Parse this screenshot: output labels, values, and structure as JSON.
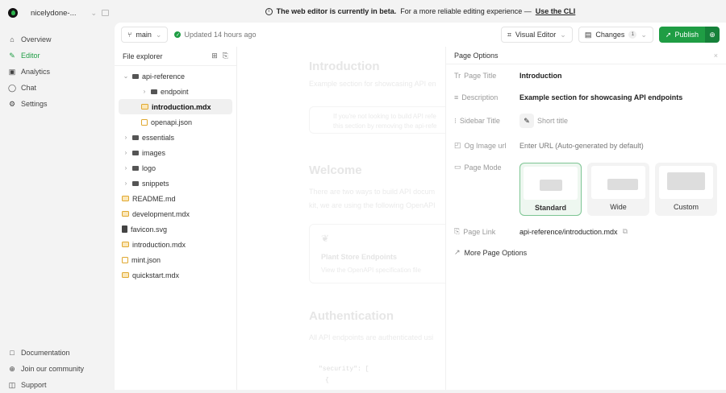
{
  "workspace": {
    "name": "nicelydone-..."
  },
  "nav": [
    {
      "label": "Overview",
      "icon": "home-icon"
    },
    {
      "label": "Editor",
      "icon": "editor-icon",
      "active": true
    },
    {
      "label": "Analytics",
      "icon": "analytics-icon"
    },
    {
      "label": "Chat",
      "icon": "chat-icon"
    },
    {
      "label": "Settings",
      "icon": "gear-icon"
    }
  ],
  "footer_nav": [
    {
      "label": "Documentation"
    },
    {
      "label": "Join our community"
    },
    {
      "label": "Support"
    }
  ],
  "banner": {
    "bold": "The web editor is currently in beta.",
    "text": "For a more reliable editing experience —",
    "link": "Use the CLI"
  },
  "toolbar": {
    "branch": "main",
    "updated": "Updated 14 hours ago",
    "visual_editor": "Visual Editor",
    "changes": "Changes",
    "changes_count": "1",
    "publish": "Publish"
  },
  "file_explorer": {
    "title": "File explorer",
    "items": [
      {
        "label": "api-reference",
        "type": "folder",
        "open": true,
        "depth": 0
      },
      {
        "label": "endpoint",
        "type": "folder",
        "depth": 1
      },
      {
        "label": "introduction.mdx",
        "type": "mdx",
        "depth": 1,
        "selected": true
      },
      {
        "label": "openapi.json",
        "type": "json",
        "depth": 1
      },
      {
        "label": "essentials",
        "type": "folder",
        "depth": 0
      },
      {
        "label": "images",
        "type": "folder",
        "depth": 0
      },
      {
        "label": "logo",
        "type": "folder",
        "depth": 0
      },
      {
        "label": "snippets",
        "type": "folder",
        "depth": 0
      },
      {
        "label": "README.md",
        "type": "mdx",
        "depth": 0
      },
      {
        "label": "development.mdx",
        "type": "mdx",
        "depth": 0
      },
      {
        "label": "favicon.svg",
        "type": "svg",
        "depth": 0
      },
      {
        "label": "introduction.mdx",
        "type": "mdx",
        "depth": 0
      },
      {
        "label": "mint.json",
        "type": "json",
        "depth": 0
      },
      {
        "label": "quickstart.mdx",
        "type": "mdx",
        "depth": 0
      }
    ]
  },
  "preview": {
    "title": "Introduction",
    "subtitle": "Example section for showcasing API en",
    "note1": "If you're not looking to build API refe",
    "note2": "this section by removing the api-refe",
    "welcome": "Welcome",
    "welcome1": "There are two ways to build API docum",
    "welcome2": "kit, we are using the following OpenAPI",
    "card_title": "Plant Store Endpoints",
    "card_desc": "View the OpenAPI specification file",
    "auth": "Authentication",
    "auth1": "All API endpoints are authenticated usi",
    "code1": "\"security\": [",
    "code2": "{"
  },
  "page_options": {
    "title": "Page Options",
    "page_title_label": "Page Title",
    "page_title": "Introduction",
    "description_label": "Description",
    "description": "Example section for showcasing API endpoints",
    "sidebar_title_label": "Sidebar Title",
    "sidebar_title_placeholder": "Short title",
    "og_label": "Og Image url",
    "og_placeholder": "Enter URL (Auto-generated by default)",
    "mode_label": "Page Mode",
    "modes": [
      "Standard",
      "Wide",
      "Custom"
    ],
    "selected_mode": "Standard",
    "link_label": "Page Link",
    "link": "api-reference/introduction.mdx",
    "more": "More Page Options"
  },
  "colors": {
    "accent": "#1f9d44"
  }
}
